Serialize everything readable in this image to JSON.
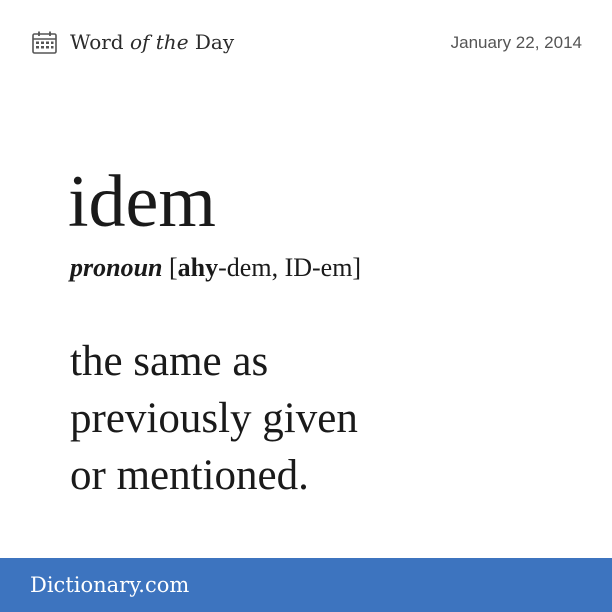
{
  "header": {
    "icon": "calendar-icon",
    "title_prefix": "Word ",
    "title_italic": "of the",
    "title_suffix": " Day",
    "date": "January 22, 2014"
  },
  "entry": {
    "word": "idem",
    "part_of_speech": "pronoun",
    "pron_open": " [",
    "pron_stressed": "ahy",
    "pron_rest": "-dem, ID-em]",
    "definition_lines": [
      "the same as",
      "previously given",
      "or mentioned."
    ]
  },
  "footer": {
    "brand": "Dictionary.com",
    "background": "#3d74bf"
  }
}
